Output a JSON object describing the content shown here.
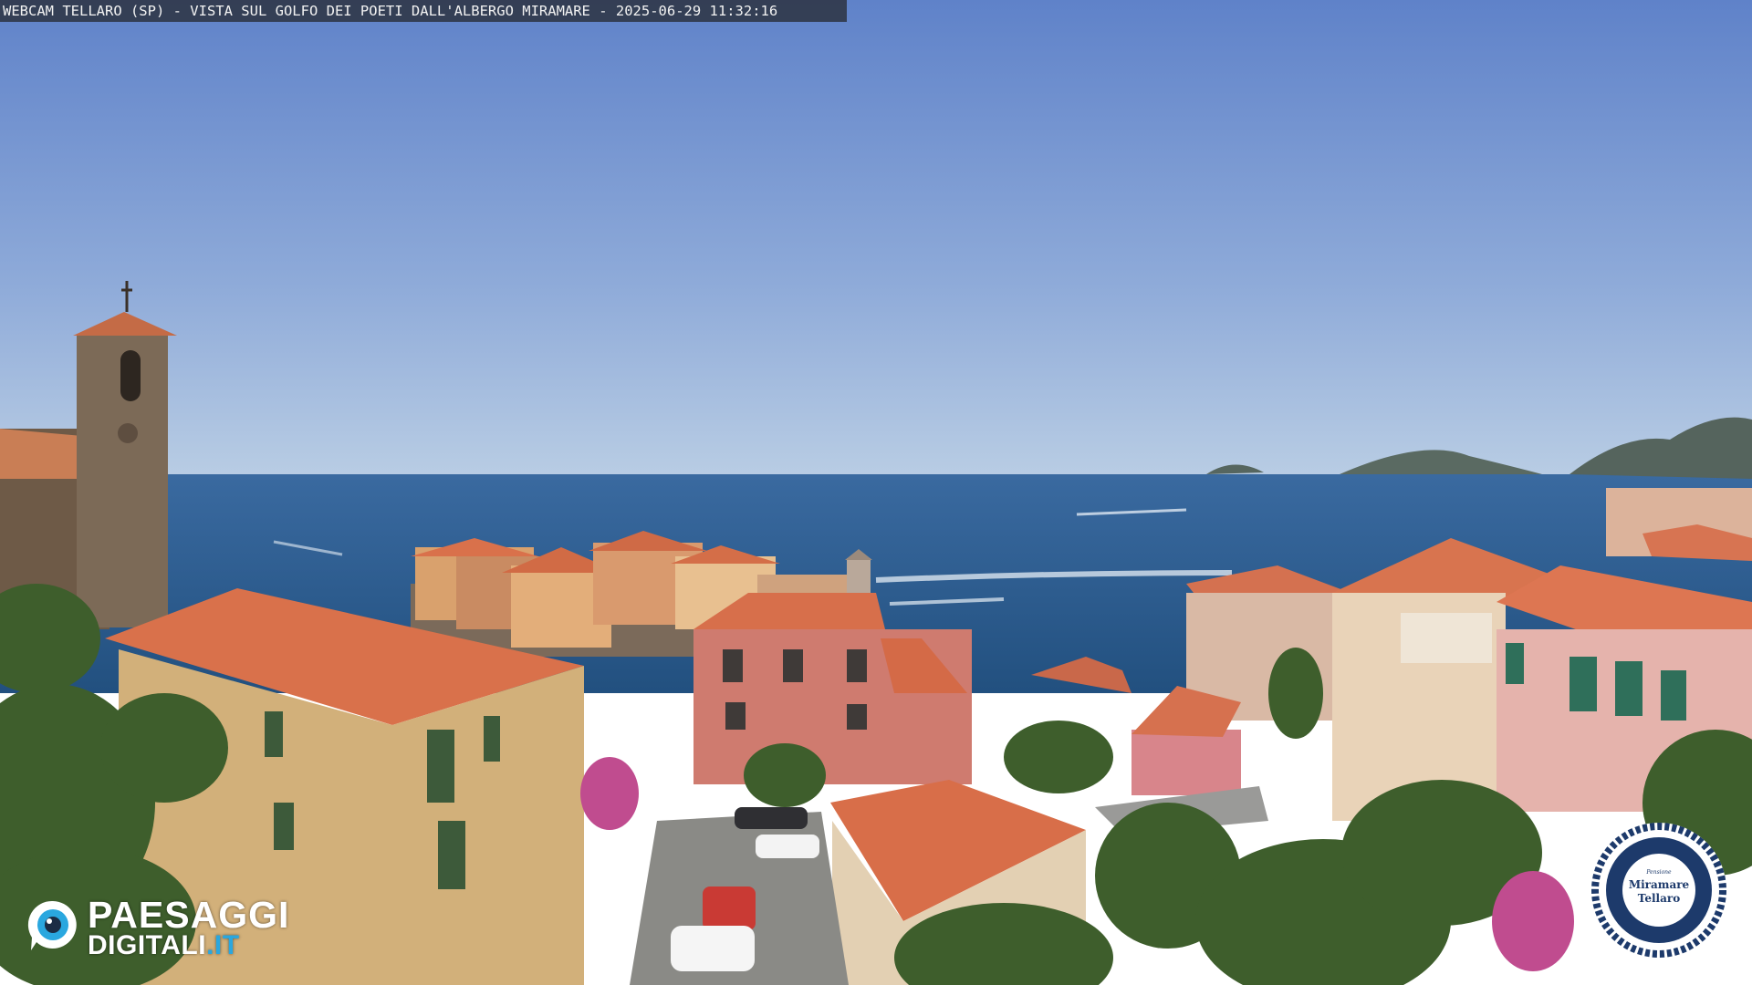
{
  "caption": "WEBCAM TELLARO (SP) - VISTA SUL GOLFO DEI POETI DALL'ALBERGO MIRAMARE - 2025-06-29 11:32:16",
  "brand": {
    "name_line1": "PAESAGGI",
    "name_line2": "DIGITALI",
    "name_tld": ".IT",
    "accent_color": "#2aa7df",
    "icon": "eye-icon"
  },
  "seal": {
    "top": "Pensione",
    "line1": "Miramare",
    "line2": "Tellaro",
    "border_color": "#1d3a6b"
  },
  "colors": {
    "sky_top": "#5f82c9",
    "sky_horizon": "#b9cde4",
    "sea": "#2c5a8e",
    "roof": "#d9714b"
  }
}
